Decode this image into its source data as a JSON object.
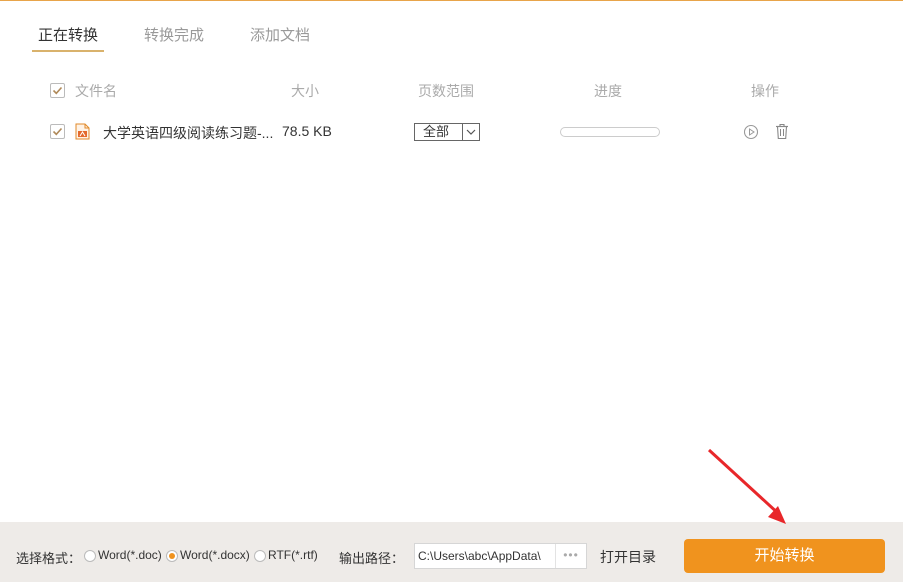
{
  "tabs": [
    {
      "label": "正在转换",
      "active": true
    },
    {
      "label": "转换完成",
      "active": false
    },
    {
      "label": "添加文档",
      "active": false
    }
  ],
  "table": {
    "headers": {
      "name": "文件名",
      "size": "大小",
      "pages": "页数范围",
      "progress": "进度",
      "actions": "操作"
    },
    "rows": [
      {
        "checked": true,
        "icon": "pdf-icon",
        "name": "大学英语四级阅读练习题-...",
        "size": "78.5 KB",
        "pages": "全部",
        "progress": 0
      }
    ]
  },
  "bottom": {
    "format_label": "选择格式：",
    "formats": [
      {
        "label": "Word(*.doc)",
        "selected": false
      },
      {
        "label": "Word(*.docx)",
        "selected": true
      },
      {
        "label": "RTF(*.rtf)",
        "selected": false
      }
    ],
    "output_label": "输出路径：",
    "output_path": "C:\\Users\\abc\\AppData\\",
    "browse_label": "•••",
    "open_dir_label": "打开目录",
    "start_label": "开始转换"
  },
  "colors": {
    "accent": "#f0931e",
    "tab_underline": "#d9b26c",
    "annotation_arrow": "#e8272a"
  }
}
